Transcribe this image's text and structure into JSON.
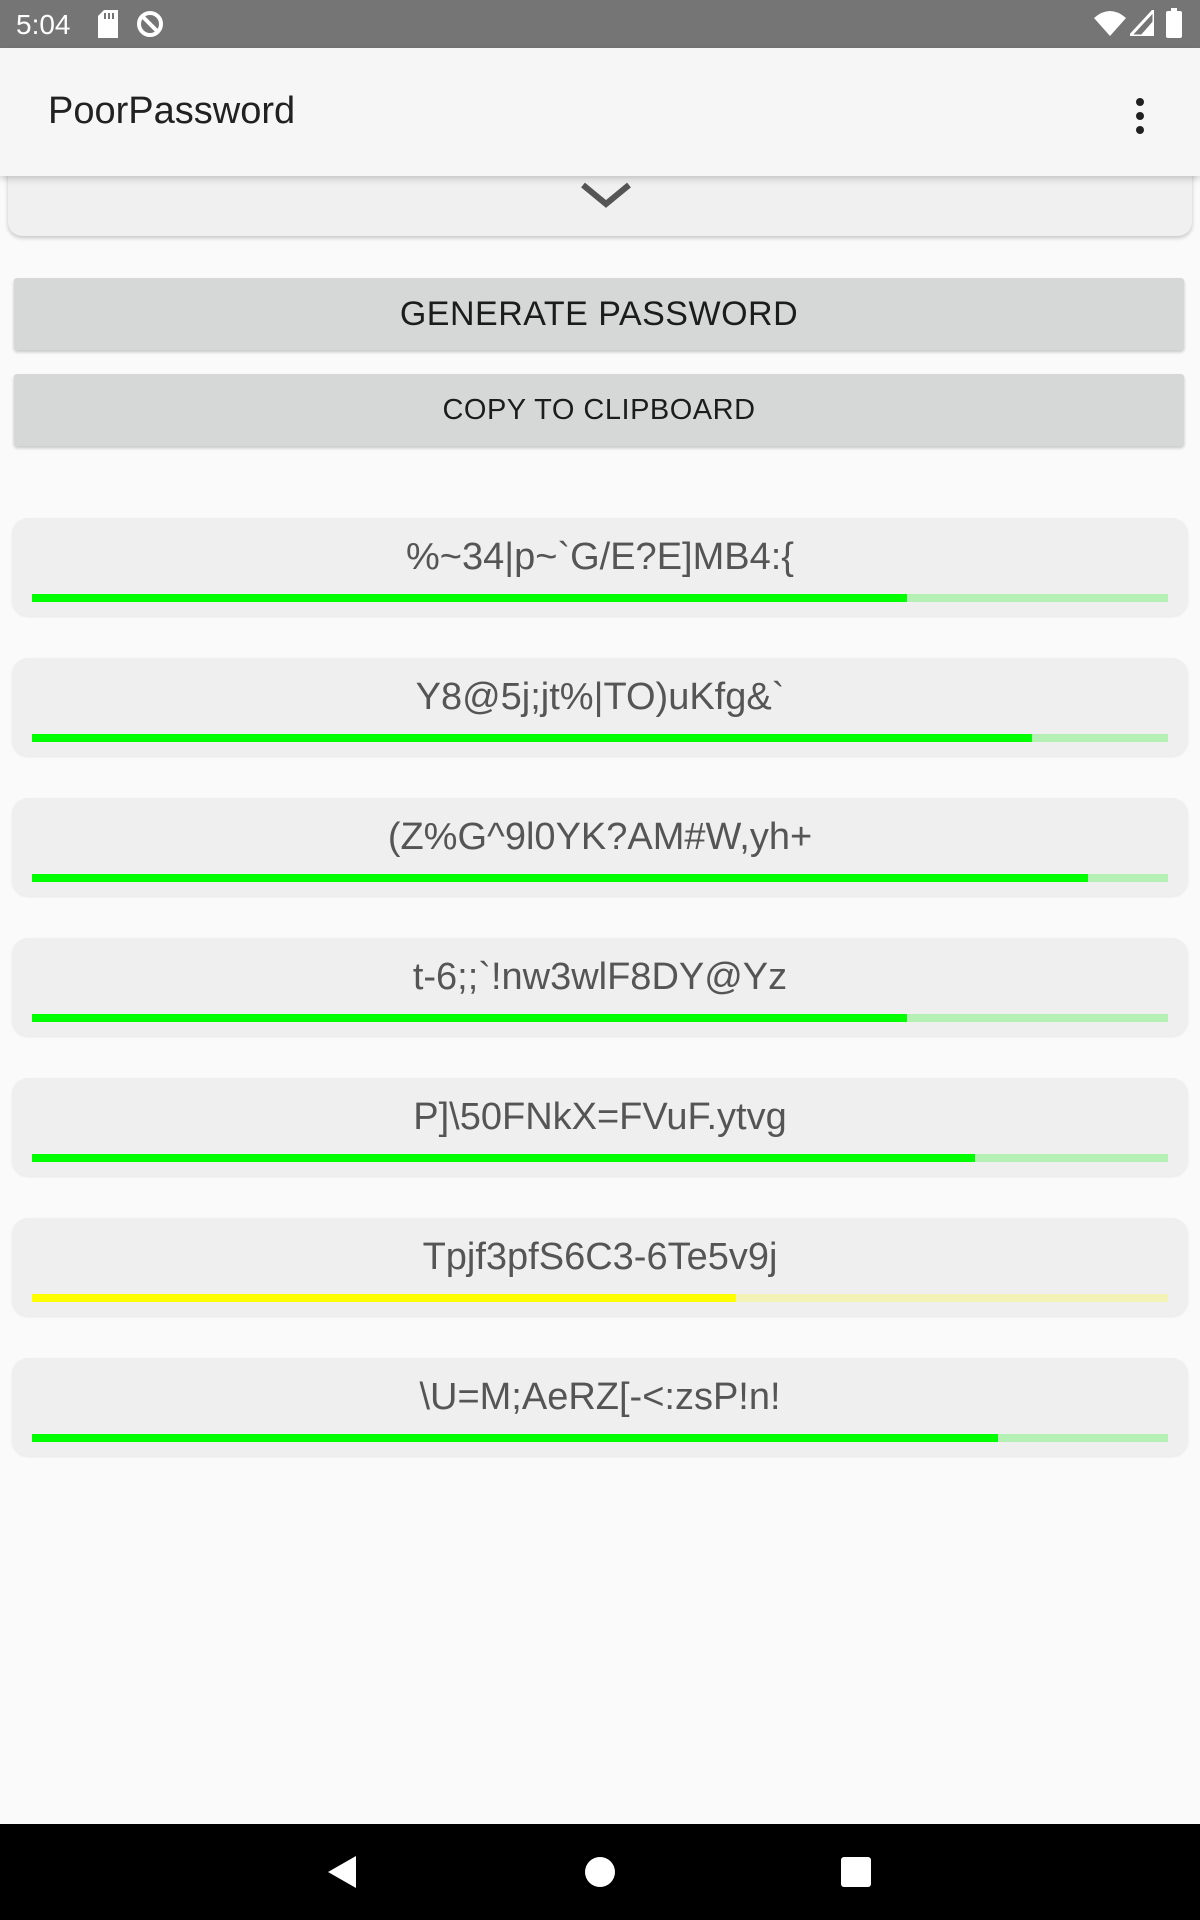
{
  "status_bar": {
    "time": "5:04"
  },
  "app_bar": {
    "title": "PoorPassword"
  },
  "actions": {
    "generate_label": "GENERATE PASSWORD",
    "copy_label": "COPY TO CLIPBOARD"
  },
  "passwords": [
    {
      "text": "%~34|p~`G/E?E]MB4:{",
      "strength": 0.77,
      "color": "#00ff00",
      "track_color": "#b5f0b5"
    },
    {
      "text": "Y8@5j;jt%|TO)uKfg&`",
      "strength": 0.88,
      "color": "#00ff00",
      "track_color": "#b5f0b5"
    },
    {
      "text": "(Z%G^9l0YK?AM#W,yh+",
      "strength": 0.93,
      "color": "#00ff00",
      "track_color": "#b5f0b5"
    },
    {
      "text": "t-6;;`!nw3wlF8DY@Yz",
      "strength": 0.77,
      "color": "#00ff00",
      "track_color": "#b5f0b5"
    },
    {
      "text": "P]\\50FNkX=FVuF.ytvg",
      "strength": 0.83,
      "color": "#00ff00",
      "track_color": "#b5f0b5"
    },
    {
      "text": "Tpjf3pfS6C3-6Te5v9j",
      "strength": 0.62,
      "color": "#ffff00",
      "track_color": "#f3f3b8"
    },
    {
      "text": "\\U=M;AeRZ[-<:zsP!n!",
      "strength": 0.85,
      "color": "#00ff00",
      "track_color": "#b5f0b5"
    }
  ]
}
